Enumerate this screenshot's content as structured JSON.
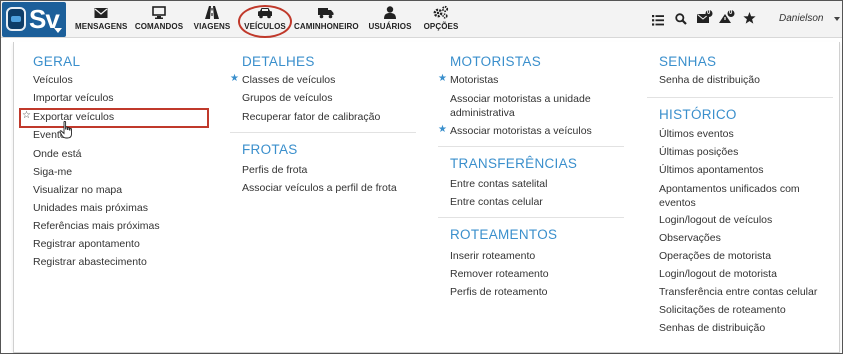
{
  "logo": {
    "text": "Sv"
  },
  "nav": {
    "items": [
      {
        "label": "MENSAGENS",
        "icon": "envelope-icon"
      },
      {
        "label": "COMANDOS",
        "icon": "monitor-icon"
      },
      {
        "label": "VIAGENS",
        "icon": "road-icon"
      },
      {
        "label": "VEÍCULOS",
        "icon": "car-icon"
      },
      {
        "label": "CAMINHONEIRO",
        "icon": "truck-icon"
      },
      {
        "label": "USUÁRIOS",
        "icon": "user-icon"
      },
      {
        "label": "OPÇÕES",
        "icon": "gears-icon"
      }
    ],
    "active_item": "VEÍCULOS"
  },
  "header_right": {
    "icons": [
      "list-icon",
      "search-icon",
      "messages-icon",
      "alerts-icon",
      "star-icon"
    ],
    "messages_badge": "0",
    "alerts_badge": "0",
    "username": "Danielson"
  },
  "menu": {
    "geral": {
      "heading": "GERAL",
      "items": [
        "Veículos",
        "Importar veículos",
        "Exportar veículos",
        "Eventos",
        "Onde está",
        "Siga-me",
        "Visualizar no mapa",
        "Unidades mais próximas",
        "Referências mais próximas",
        "Registrar apontamento",
        "Registrar abastecimento"
      ]
    },
    "detalhes": {
      "heading": "DETALHES",
      "items": [
        "Classes de veículos",
        "Grupos de veículos",
        "Recuperar fator de calibração"
      ]
    },
    "frotas": {
      "heading": "FROTAS",
      "items": [
        "Perfis de frota",
        "Associar veículos a perfil de frota"
      ]
    },
    "motoristas": {
      "heading": "MOTORISTAS",
      "items": [
        "Motoristas",
        "Associar motoristas a unidade administrativa",
        "Associar motoristas a veículos"
      ]
    },
    "transferencias": {
      "heading": "TRANSFERÊNCIAS",
      "items": [
        "Entre contas satelital",
        "Entre contas celular"
      ]
    },
    "roteamentos": {
      "heading": "ROTEAMENTOS",
      "items": [
        "Inserir roteamento",
        "Remover roteamento",
        "Perfis de roteamento"
      ]
    },
    "senhas": {
      "heading": "SENHAS",
      "items": [
        "Senha de distribuição"
      ]
    },
    "historico": {
      "heading": "HISTÓRICO",
      "items": [
        "Últimos eventos",
        "Últimas posições",
        "Últimos apontamentos",
        "Apontamentos unificados com eventos",
        "Login/logout de veículos",
        "Observações",
        "Operações de motorista",
        "Login/logout de motorista",
        "Transferência entre contas celular",
        "Solicitações de roteamento",
        "Senhas de distribuição"
      ]
    }
  },
  "colors": {
    "accent": "#3a8fcc",
    "highlight": "#c0392b",
    "brand": "#1c5f9a"
  }
}
